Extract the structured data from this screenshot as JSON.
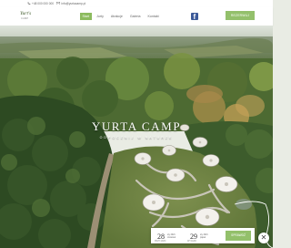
{
  "topbar": {
    "phone": "+48 000 000 000",
    "email": "info@yurtacamp.pl"
  },
  "header": {
    "logo_title": "Yurt's",
    "logo_subtitle": "CAMP",
    "nav": [
      "Start",
      "Jurty",
      "Atrakcje",
      "Galeria",
      "Kontakt"
    ],
    "active_nav": 0,
    "social_icon": "facebook-icon",
    "reserve_label": "REZERWUJ"
  },
  "hero": {
    "title": "YURTA CAMP",
    "subtitle": "odpocznij w naturze"
  },
  "booking": {
    "checkin_label": "PRZYJAZD",
    "checkin_day": "28",
    "checkin_month": "sty 2021",
    "checkin_weekday": "czwartek",
    "checkout_label": "WYJAZD",
    "checkout_day": "29",
    "checkout_month": "sty 2021",
    "checkout_weekday": "piątek",
    "button_label": "SPRAWDŹ"
  },
  "colors": {
    "accent": "#93c06b",
    "facebook": "#3b5998",
    "forest_dark": "#2f4a25",
    "forest_light": "#6b8a45"
  }
}
